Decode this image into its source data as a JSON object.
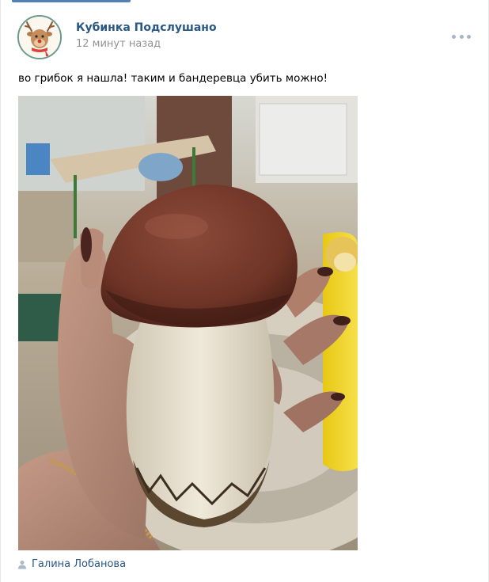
{
  "post": {
    "author": "Кубинка Подслушано",
    "time": "12 минут назад",
    "text": "во грибок я нашла! таким и бандеревца убить можно!",
    "signer": "Галина Лобанова"
  },
  "icons": {
    "avatar": "reindeer-avatar",
    "more": "more-dots-icon",
    "signer": "user-icon"
  },
  "colors": {
    "link": "#2a5885",
    "meta": "#939393",
    "accent": "#5181b8"
  }
}
